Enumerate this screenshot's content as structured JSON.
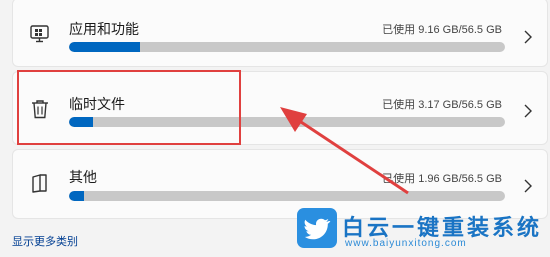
{
  "items": [
    {
      "title": "应用和功能",
      "usage": "已使用 9.16 GB/56.5 GB",
      "fraction": 0.162,
      "icon": "apps-monitor-icon"
    },
    {
      "title": "临时文件",
      "usage": "已使用 3.17 GB/56.5 GB",
      "fraction": 0.056,
      "icon": "trash-icon"
    },
    {
      "title": "其他",
      "usage": "已使用 1.96 GB/56.5 GB",
      "fraction": 0.035,
      "icon": "other-files-icon"
    }
  ],
  "more_link": "显示更多类别",
  "watermark": {
    "text": "白云一键重装系统",
    "url": "www.baiyunxitong.com"
  },
  "colors": {
    "accent": "#0067c0",
    "track": "#c8c8c8",
    "annotation": "#e0403f",
    "watermark": "#1a74c4"
  }
}
